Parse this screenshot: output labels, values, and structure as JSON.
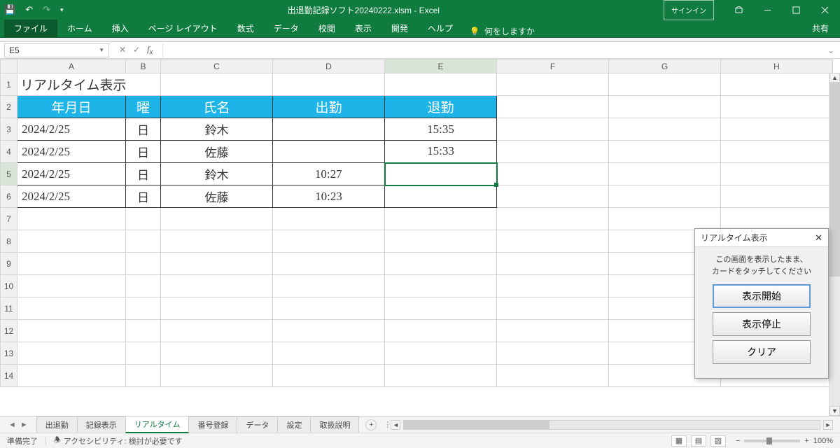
{
  "window": {
    "title": "出退勤記録ソフト20240222.xlsm  -  Excel",
    "signin": "サインイン"
  },
  "qat": {
    "save": "💾",
    "undo": "↶",
    "redo": "↷",
    "custom": "▾"
  },
  "ribbon": {
    "tabs": [
      "ファイル",
      "ホーム",
      "挿入",
      "ページ レイアウト",
      "数式",
      "データ",
      "校閲",
      "表示",
      "開発",
      "ヘルプ"
    ],
    "tellme": "何をしますか",
    "share": "共有"
  },
  "namebox": "E5",
  "columns": [
    "A",
    "B",
    "C",
    "D",
    "E",
    "F",
    "G",
    "H"
  ],
  "rows": [
    "1",
    "2",
    "3",
    "4",
    "5",
    "6",
    "7",
    "8",
    "9",
    "10",
    "11",
    "12",
    "13",
    "14"
  ],
  "sheet": {
    "title_cell": "リアルタイム表示",
    "headers": {
      "A": "年月日",
      "B": "曜",
      "C": "氏名",
      "D": "出勤",
      "E": "退勤"
    },
    "data": [
      {
        "A": "2024/2/25",
        "B": "日",
        "C": "鈴木",
        "D": "",
        "E": "15:35"
      },
      {
        "A": "2024/2/25",
        "B": "日",
        "C": "佐藤",
        "D": "",
        "E": "15:33"
      },
      {
        "A": "2024/2/25",
        "B": "日",
        "C": "鈴木",
        "D": "10:27",
        "E": ""
      },
      {
        "A": "2024/2/25",
        "B": "日",
        "C": "佐藤",
        "D": "10:23",
        "E": ""
      }
    ]
  },
  "sheet_tabs": [
    "出退勤",
    "記録表示",
    "リアルタイム",
    "番号登録",
    "データ",
    "設定",
    "取扱説明"
  ],
  "active_sheet": "リアルタイム",
  "dialog": {
    "title": "リアルタイム表示",
    "message1": "この画面を表示したまま、",
    "message2": "カードをタッチしてください",
    "btn_start": "表示開始",
    "btn_stop": "表示停止",
    "btn_clear": "クリア"
  },
  "status": {
    "ready": "準備完了",
    "acc_label": "アクセシビリティ: 検討が必要です",
    "zoom": "100%"
  }
}
